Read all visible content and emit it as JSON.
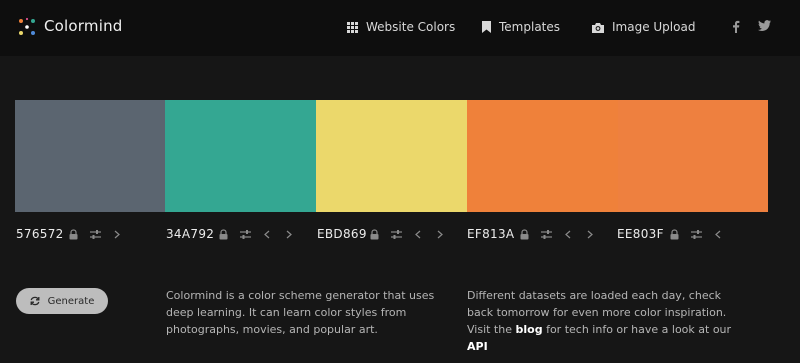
{
  "header": {
    "brand": "Colormind",
    "nav": {
      "website_colors": "Website Colors",
      "templates": "Templates",
      "image_upload": "Image Upload"
    },
    "social": [
      "facebook-icon",
      "twitter-icon"
    ]
  },
  "palette": [
    {
      "hex": "576572",
      "color": "#5b6570"
    },
    {
      "hex": "34A792",
      "color": "#34a792"
    },
    {
      "hex": "EBD869",
      "color": "#ebd86b"
    },
    {
      "hex": "EF813A",
      "color": "#ef813a"
    },
    {
      "hex": "EE803F",
      "color": "#ee803f"
    }
  ],
  "generate_button": "Generate",
  "about": {
    "text": "Colormind is a color scheme generator that uses deep learning. It can learn color styles from photographs, movies, and popular art."
  },
  "datasets": {
    "text_a": "Different datasets are loaded each day, check back tomorrow for even more color inspiration. Visit the",
    "blog_link": "blog",
    "text_b": "for tech info or have a look at our",
    "api_link": "API"
  }
}
